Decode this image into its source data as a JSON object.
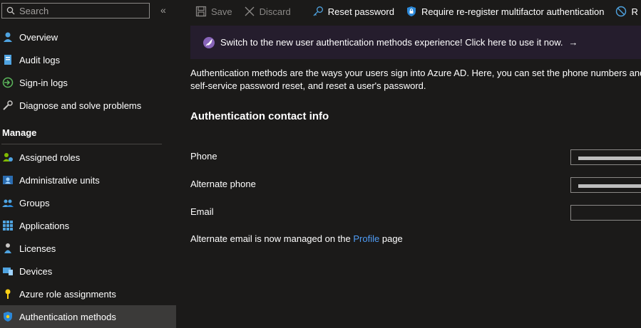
{
  "sidebar": {
    "search_placeholder": "Search",
    "collapse_label": "«",
    "items": [
      {
        "label": "Overview",
        "icon": "info-person-icon"
      },
      {
        "label": "Audit logs",
        "icon": "audit-log-icon"
      },
      {
        "label": "Sign-in logs",
        "icon": "sign-in-icon"
      },
      {
        "label": "Diagnose and solve problems",
        "icon": "wrench-icon"
      }
    ],
    "manage_title": "Manage",
    "manage_items": [
      {
        "label": "Assigned roles",
        "icon": "person-role-icon"
      },
      {
        "label": "Administrative units",
        "icon": "admin-units-icon"
      },
      {
        "label": "Groups",
        "icon": "groups-icon"
      },
      {
        "label": "Applications",
        "icon": "apps-grid-icon"
      },
      {
        "label": "Licenses",
        "icon": "licenses-icon"
      },
      {
        "label": "Devices",
        "icon": "devices-icon"
      },
      {
        "label": "Azure role assignments",
        "icon": "key-icon"
      },
      {
        "label": "Authentication methods",
        "icon": "shield-icon"
      }
    ]
  },
  "toolbar": {
    "save_label": "Save",
    "discard_label": "Discard",
    "reset_password_label": "Reset password",
    "require_mfa_label": "Require re-register multifactor authentication",
    "revoke_label": "R"
  },
  "banner": {
    "text": "Switch to the new user authentication methods experience! Click here to use it now.",
    "arrow": "→"
  },
  "intro": {
    "line1": "Authentication methods are the ways your users sign into Azure AD. Here, you can set the phone numbers and",
    "line2": "self-service password reset, and reset a user's password."
  },
  "section": {
    "heading": "Authentication contact info"
  },
  "fields": {
    "phone_label": "Phone",
    "alt_phone_label": "Alternate phone",
    "email_label": "Email"
  },
  "note": {
    "prefix": "Alternate email is now managed on the",
    "link": "Profile",
    "suffix": "page"
  },
  "colors": {
    "background": "#1b1a19",
    "banner": "#251d2d",
    "link": "#4f9cf5",
    "active_item": "#3b3a39"
  }
}
